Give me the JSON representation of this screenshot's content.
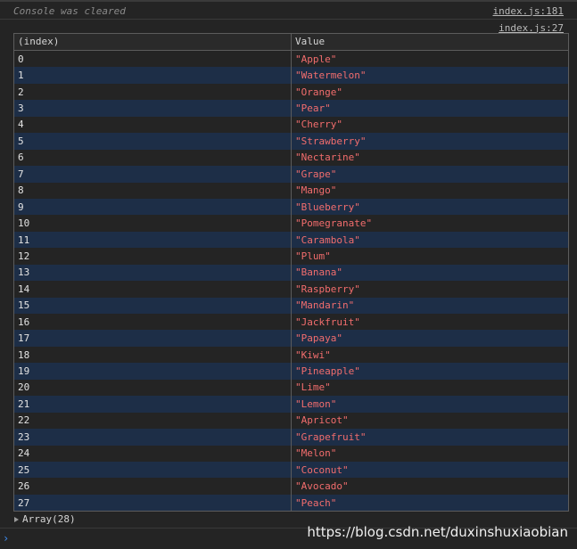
{
  "console": {
    "cleared_text": "Console was cleared",
    "cleared_source": "index.js:181",
    "table_source": "index.js:27",
    "array_summary": "Array(28)",
    "prompt_symbol": "›"
  },
  "table": {
    "headers": [
      "(index)",
      "Value"
    ],
    "rows": [
      {
        "index": "0",
        "value": "\"Apple\""
      },
      {
        "index": "1",
        "value": "\"Watermelon\""
      },
      {
        "index": "2",
        "value": "\"Orange\""
      },
      {
        "index": "3",
        "value": "\"Pear\""
      },
      {
        "index": "4",
        "value": "\"Cherry\""
      },
      {
        "index": "5",
        "value": "\"Strawberry\""
      },
      {
        "index": "6",
        "value": "\"Nectarine\""
      },
      {
        "index": "7",
        "value": "\"Grape\""
      },
      {
        "index": "8",
        "value": "\"Mango\""
      },
      {
        "index": "9",
        "value": "\"Blueberry\""
      },
      {
        "index": "10",
        "value": "\"Pomegranate\""
      },
      {
        "index": "11",
        "value": "\"Carambola\""
      },
      {
        "index": "12",
        "value": "\"Plum\""
      },
      {
        "index": "13",
        "value": "\"Banana\""
      },
      {
        "index": "14",
        "value": "\"Raspberry\""
      },
      {
        "index": "15",
        "value": "\"Mandarin\""
      },
      {
        "index": "16",
        "value": "\"Jackfruit\""
      },
      {
        "index": "17",
        "value": "\"Papaya\""
      },
      {
        "index": "18",
        "value": "\"Kiwi\""
      },
      {
        "index": "19",
        "value": "\"Pineapple\""
      },
      {
        "index": "20",
        "value": "\"Lime\""
      },
      {
        "index": "21",
        "value": "\"Lemon\""
      },
      {
        "index": "22",
        "value": "\"Apricot\""
      },
      {
        "index": "23",
        "value": "\"Grapefruit\""
      },
      {
        "index": "24",
        "value": "\"Melon\""
      },
      {
        "index": "25",
        "value": "\"Coconut\""
      },
      {
        "index": "26",
        "value": "\"Avocado\""
      },
      {
        "index": "27",
        "value": "\"Peach\""
      }
    ]
  },
  "watermark": "https://blog.csdn.net/duxinshuxiaobian",
  "colors": {
    "background": "#242424",
    "stripe": "#1d2e47",
    "string_value": "#f26d6d",
    "prompt": "#3d8bf0"
  }
}
